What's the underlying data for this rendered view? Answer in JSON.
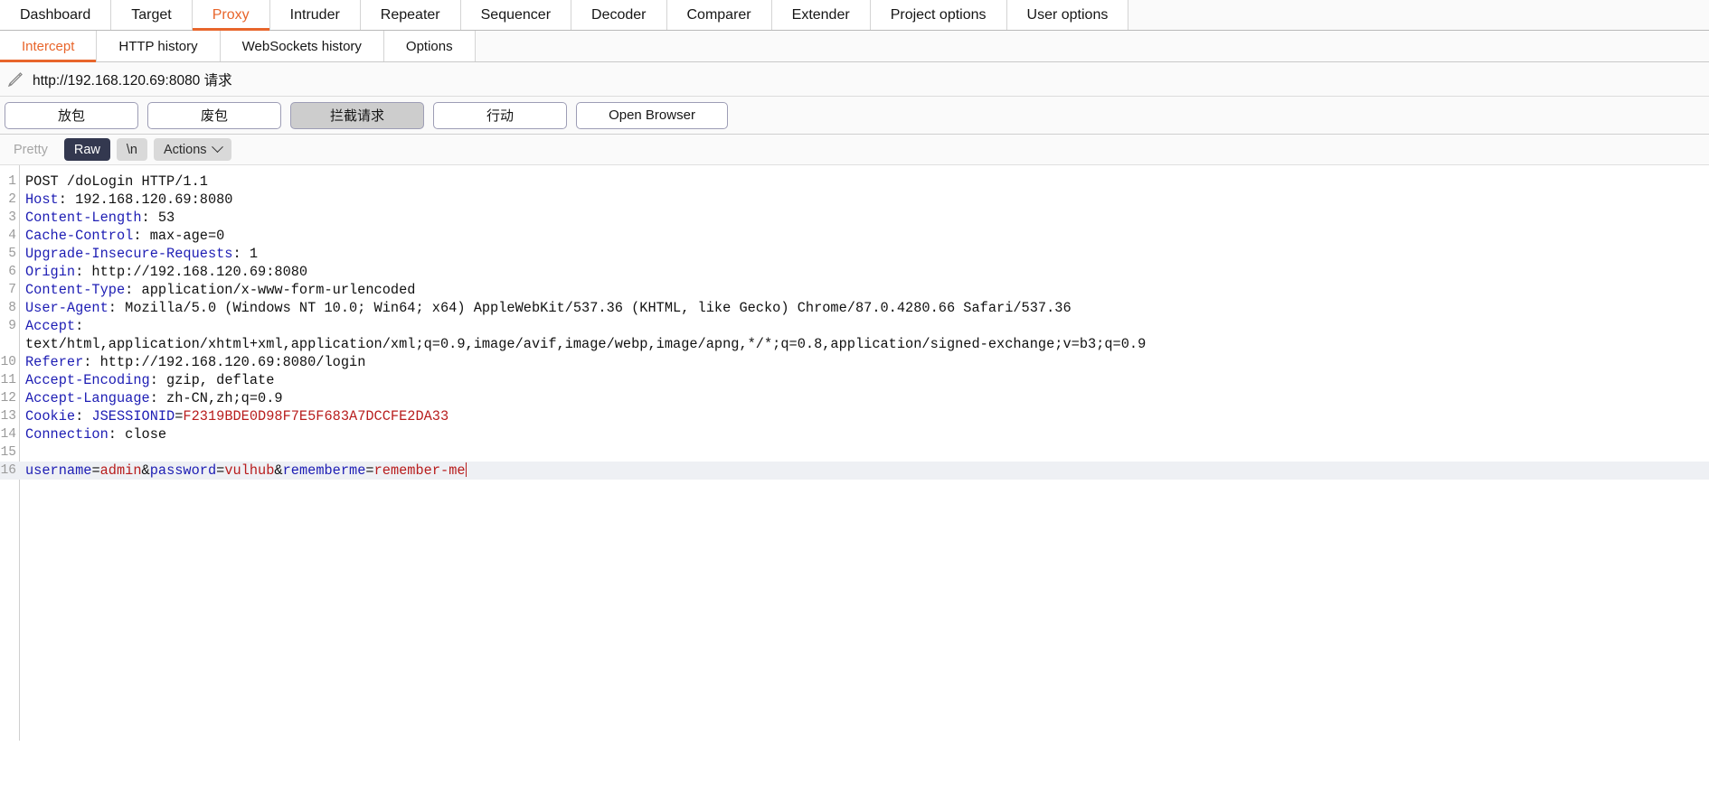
{
  "main_tabs": [
    {
      "label": "Dashboard",
      "active": false
    },
    {
      "label": "Target",
      "active": false
    },
    {
      "label": "Proxy",
      "active": true
    },
    {
      "label": "Intruder",
      "active": false
    },
    {
      "label": "Repeater",
      "active": false
    },
    {
      "label": "Sequencer",
      "active": false
    },
    {
      "label": "Decoder",
      "active": false
    },
    {
      "label": "Comparer",
      "active": false
    },
    {
      "label": "Extender",
      "active": false
    },
    {
      "label": "Project options",
      "active": false
    },
    {
      "label": "User options",
      "active": false
    }
  ],
  "sub_tabs": [
    {
      "label": "Intercept",
      "active": true
    },
    {
      "label": "HTTP history",
      "active": false
    },
    {
      "label": "WebSockets history",
      "active": false
    },
    {
      "label": "Options",
      "active": false
    }
  ],
  "url_bar": {
    "icon": "pencil-icon",
    "text": "http://192.168.120.69:8080 请求"
  },
  "buttons": [
    {
      "label": "放包",
      "pressed": false
    },
    {
      "label": "废包",
      "pressed": false
    },
    {
      "label": "拦截请求",
      "pressed": true
    },
    {
      "label": "行动",
      "pressed": false
    },
    {
      "label": "Open Browser",
      "pressed": false
    }
  ],
  "editor_toolbar": {
    "pretty": "Pretty",
    "raw": "Raw",
    "newline": "\\n",
    "actions": "Actions",
    "chevron": "chevron-down-icon"
  },
  "request": {
    "lines": [
      {
        "no": 1,
        "segments": [
          {
            "t": "POST /doLogin HTTP/1.1",
            "c": "hval"
          }
        ]
      },
      {
        "no": 2,
        "segments": [
          {
            "t": "Host",
            "c": "hname"
          },
          {
            "t": ": 192.168.120.69:8080",
            "c": "hval"
          }
        ]
      },
      {
        "no": 3,
        "segments": [
          {
            "t": "Content-Length",
            "c": "hname"
          },
          {
            "t": ": 53",
            "c": "hval"
          }
        ]
      },
      {
        "no": 4,
        "segments": [
          {
            "t": "Cache-Control",
            "c": "hname"
          },
          {
            "t": ": max-age=0",
            "c": "hval"
          }
        ]
      },
      {
        "no": 5,
        "segments": [
          {
            "t": "Upgrade-Insecure-Requests",
            "c": "hname"
          },
          {
            "t": ": 1",
            "c": "hval"
          }
        ]
      },
      {
        "no": 6,
        "segments": [
          {
            "t": "Origin",
            "c": "hname"
          },
          {
            "t": ": http://192.168.120.69:8080",
            "c": "hval"
          }
        ]
      },
      {
        "no": 7,
        "segments": [
          {
            "t": "Content-Type",
            "c": "hname"
          },
          {
            "t": ": application/x-www-form-urlencoded",
            "c": "hval"
          }
        ]
      },
      {
        "no": 8,
        "segments": [
          {
            "t": "User-Agent",
            "c": "hname"
          },
          {
            "t": ": Mozilla/5.0 (Windows NT 10.0; Win64; x64) AppleWebKit/537.36 (KHTML, like Gecko) Chrome/87.0.4280.66 Safari/537.36",
            "c": "hval"
          }
        ]
      },
      {
        "no": 9,
        "segments": [
          {
            "t": "Accept",
            "c": "hname"
          },
          {
            "t": ":\ntext/html,application/xhtml+xml,application/xml;q=0.9,image/avif,image/webp,image/apng,*/*;q=0.8,application/signed-exchange;v=b3;q=0.9",
            "c": "hval"
          }
        ]
      },
      {
        "no": 10,
        "segments": [
          {
            "t": "Referer",
            "c": "hname"
          },
          {
            "t": ": http://192.168.120.69:8080/login",
            "c": "hval"
          }
        ]
      },
      {
        "no": 11,
        "segments": [
          {
            "t": "Accept-Encoding",
            "c": "hname"
          },
          {
            "t": ": gzip, deflate",
            "c": "hval"
          }
        ]
      },
      {
        "no": 12,
        "segments": [
          {
            "t": "Accept-Language",
            "c": "hname"
          },
          {
            "t": ": zh-CN,zh;q=0.9",
            "c": "hval"
          }
        ]
      },
      {
        "no": 13,
        "segments": [
          {
            "t": "Cookie",
            "c": "hname"
          },
          {
            "t": ": ",
            "c": "hval"
          },
          {
            "t": "JSESSIONID",
            "c": "pname"
          },
          {
            "t": "=",
            "c": "punct"
          },
          {
            "t": "F2319BDE0D98F7E5F683A7DCCFE2DA33",
            "c": "pval"
          }
        ]
      },
      {
        "no": 14,
        "segments": [
          {
            "t": "Connection",
            "c": "hname"
          },
          {
            "t": ": close",
            "c": "hval"
          }
        ]
      },
      {
        "no": 15,
        "segments": [
          {
            "t": "",
            "c": "hval"
          }
        ]
      },
      {
        "no": 16,
        "highlight": true,
        "caret": true,
        "segments": [
          {
            "t": "username",
            "c": "pname"
          },
          {
            "t": "=",
            "c": "punct"
          },
          {
            "t": "admin",
            "c": "pval"
          },
          {
            "t": "&",
            "c": "punct"
          },
          {
            "t": "password",
            "c": "pname"
          },
          {
            "t": "=",
            "c": "punct"
          },
          {
            "t": "vulhub",
            "c": "pval"
          },
          {
            "t": "&",
            "c": "punct"
          },
          {
            "t": "rememberme",
            "c": "pname"
          },
          {
            "t": "=",
            "c": "punct"
          },
          {
            "t": "remember-me",
            "c": "pval"
          }
        ]
      }
    ]
  },
  "colors": {
    "accent": "#e8652b",
    "selected_seg": "#33384f",
    "header_name": "#1d1db4",
    "param_value": "#b81d1d",
    "highlight_row": "#eef0f4"
  }
}
